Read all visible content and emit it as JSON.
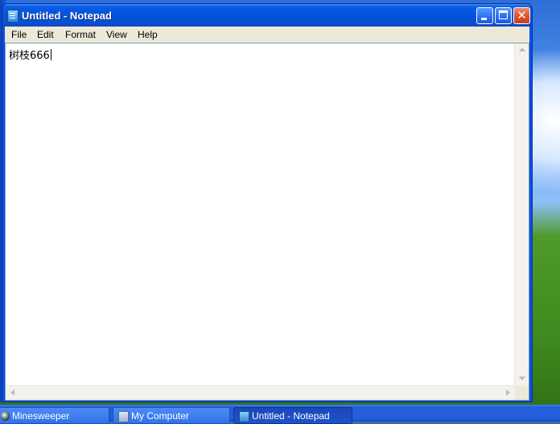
{
  "window": {
    "title": "Untitled - Notepad",
    "controls": {
      "minimize": "minimize",
      "maximize": "maximize",
      "close": "✕"
    }
  },
  "menu": [
    {
      "label": "File"
    },
    {
      "label": "Edit"
    },
    {
      "label": "Format"
    },
    {
      "label": "View"
    },
    {
      "label": "Help"
    }
  ],
  "editor": {
    "content": "树枝666"
  },
  "taskbar": [
    {
      "label": "Minesweeper",
      "icon": "minesweeper-icon",
      "active": false
    },
    {
      "label": "My Computer",
      "icon": "computer-icon",
      "active": false
    },
    {
      "label": "Untitled - Notepad",
      "icon": "notepad-icon",
      "active": true
    }
  ],
  "colors": {
    "titlebar": "#0553d8",
    "menubar": "#ece9d8",
    "taskbar": "#245edb"
  }
}
